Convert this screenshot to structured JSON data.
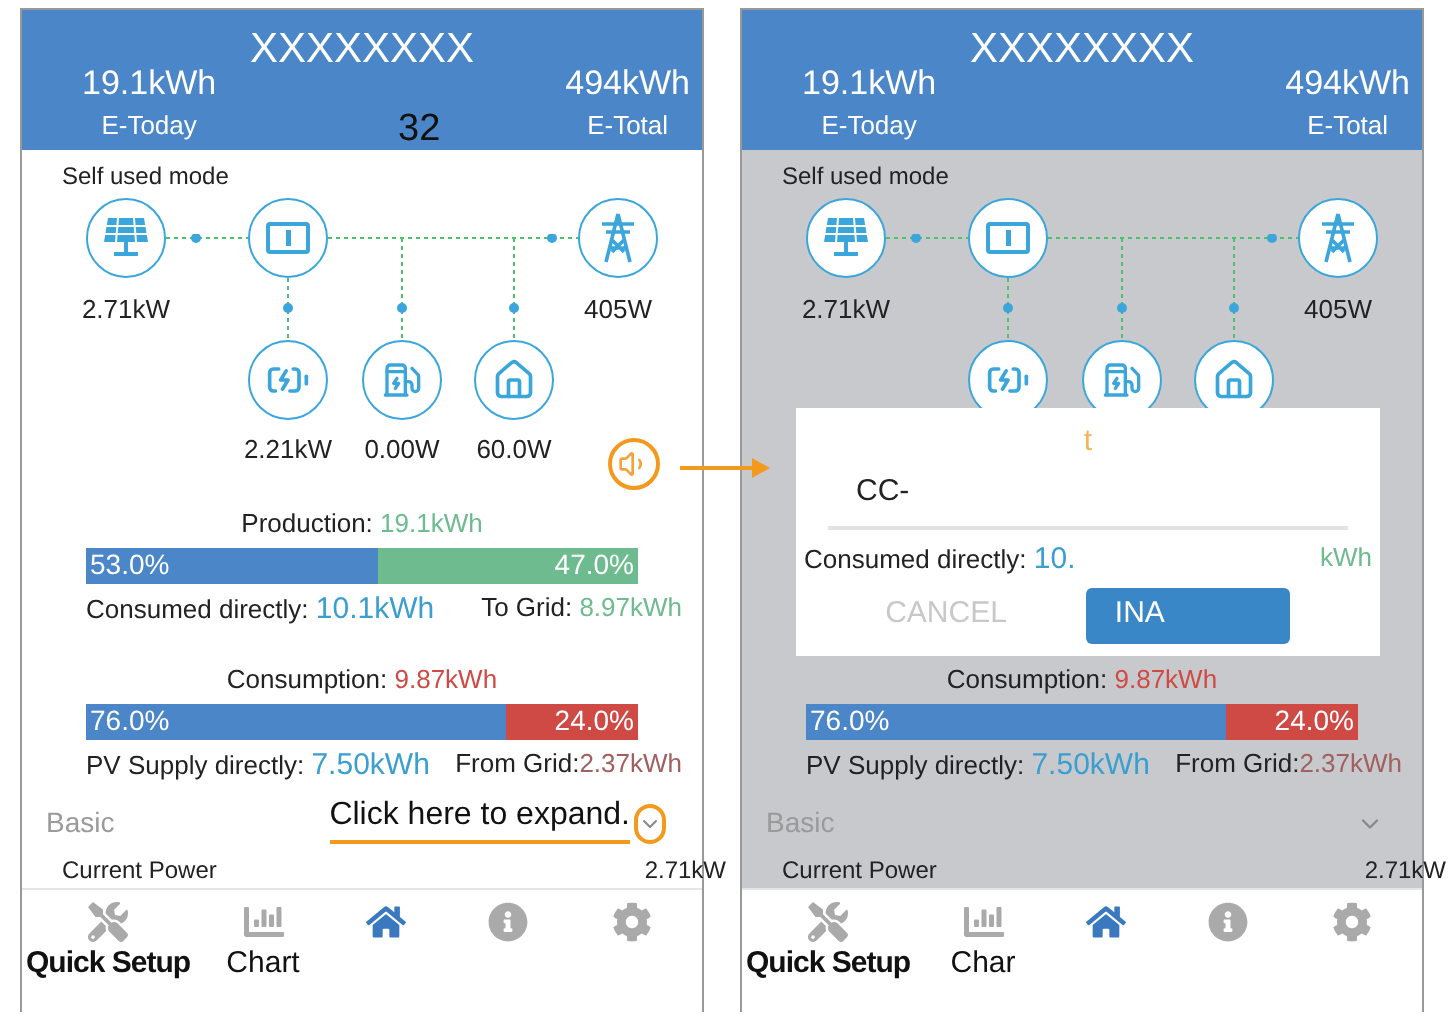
{
  "screens": [
    {
      "dimmed": false,
      "header": {
        "title": "XXXXXXXX",
        "today_value": "19.1kWh",
        "today_label": "E-Today",
        "total_value": "494kWh",
        "total_label": "E-Total",
        "page_number": "32"
      },
      "mode": "Self used mode",
      "flow": {
        "solar": "2.71kW",
        "grid": "405W",
        "battery": "2.21kW",
        "charger": "0.00W",
        "home": "60.0W"
      },
      "speaker_highlighted": true,
      "production": {
        "label": "Production: ",
        "value": "19.1kWh",
        "segments": [
          {
            "text": "53.0%",
            "level": 0.53,
            "color": "#4a86c8"
          },
          {
            "text": "47.0%",
            "level": 0.47,
            "color": "#6dbb8e"
          }
        ],
        "left_label": "Consumed directly: ",
        "left_value": "10.1kWh",
        "right_label": "To Grid: ",
        "right_value": "8.97kWh"
      },
      "consumption": {
        "label": "Consumption: ",
        "value": "9.87kWh",
        "segments": [
          {
            "text": "76.0%",
            "level": 0.76,
            "color": "#4a86c8"
          },
          {
            "text": "24.0%",
            "level": 0.24,
            "color": "#d04a45"
          }
        ],
        "left_label": "PV Supply directly: ",
        "left_value": "7.50kWh",
        "right_label": "From Grid:",
        "right_value": "2.37kWh"
      },
      "basic": {
        "title": "Basic",
        "hint": "Click here to expand.",
        "chevron_highlighted": true,
        "rows": [
          {
            "label": "Current Power",
            "value": "2.71kW"
          }
        ]
      },
      "nav": [
        {
          "kind": "tools",
          "label": "Quick Setup",
          "selected": false
        },
        {
          "kind": "chart",
          "label": "Chart",
          "selected": false
        },
        {
          "kind": "home",
          "selected": true
        },
        {
          "kind": "info",
          "selected": false
        },
        {
          "kind": "settings",
          "selected": false
        }
      ]
    },
    {
      "dimmed": true,
      "header": {
        "title": "XXXXXXXX",
        "today_value": "19.1kWh",
        "today_label": "E-Today",
        "total_value": "494kWh",
        "total_label": "E-Total"
      },
      "mode": "Self used mode",
      "flow": {
        "solar": "2.71kW",
        "grid": "405W"
      },
      "speaker_highlighted": false,
      "dialog": {
        "title": "t",
        "field_value": "CC-",
        "behind_label": "Consumed directly: ",
        "behind_value": "10.",
        "behind_right": "kWh",
        "buttons": [
          {
            "kind": "text",
            "label": "CANCEL"
          },
          {
            "kind": "primary",
            "label": "INA"
          }
        ]
      },
      "consumption": {
        "label": "Consumption: ",
        "value": "9.87kWh",
        "segments": [
          {
            "text": "76.0%",
            "level": 0.76,
            "color": "#4a86c8"
          },
          {
            "text": "24.0%",
            "level": 0.24,
            "color": "#d04a45"
          }
        ],
        "left_label": "PV Supply directly: ",
        "left_value": "7.50kWh",
        "right_label": "From Grid:",
        "right_value": "2.37kWh"
      },
      "basic": {
        "title": "Basic",
        "chevron_highlighted": false,
        "rows": [
          {
            "label": "Current Power",
            "value": "2.71kW"
          }
        ]
      },
      "nav": [
        {
          "kind": "tools",
          "label": "Quick Setup",
          "selected": false
        },
        {
          "kind": "chart",
          "label": "Char",
          "selected": false
        },
        {
          "kind": "home",
          "selected": true
        },
        {
          "kind": "info",
          "selected": false
        },
        {
          "kind": "settings",
          "selected": false
        }
      ]
    }
  ]
}
